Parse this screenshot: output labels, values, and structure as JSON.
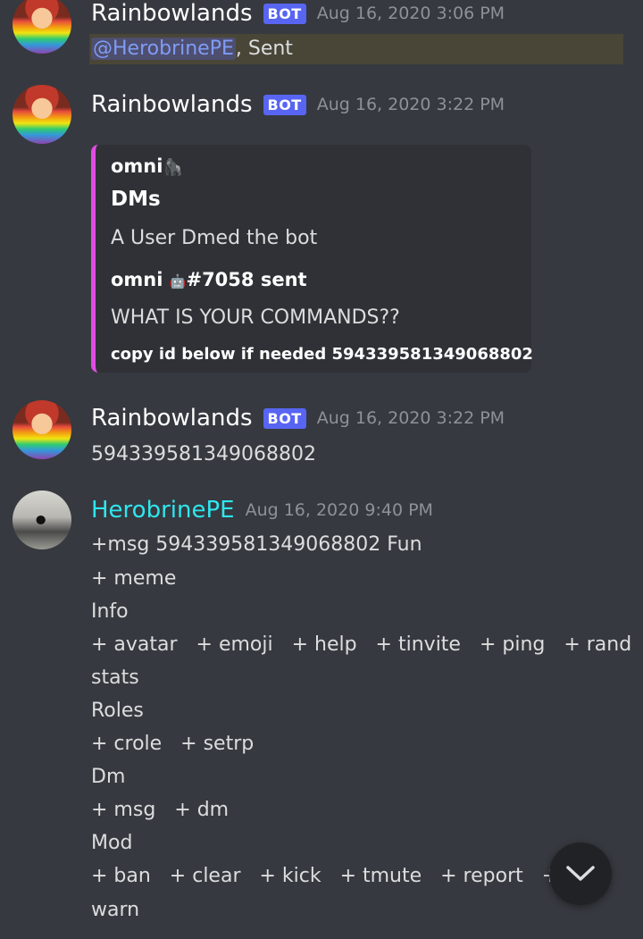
{
  "messages": [
    {
      "author": "Rainbowlands",
      "bot_tag": "BOT",
      "timestamp": "Aug 16, 2020 3:06 PM",
      "mention": "@HerobrinePE",
      "content_after_mention": ", Sent"
    },
    {
      "author": "Rainbowlands",
      "bot_tag": "BOT",
      "timestamp": "Aug 16, 2020 3:22 PM",
      "embed": {
        "author": "omni",
        "title": "DMs",
        "description": "A User Dmed the bot",
        "field_name_prefix": "omni",
        "field_name_suffix": "#7058 sent",
        "field_value": "WHAT IS YOUR COMMANDS??",
        "footer": "copy id below if needed 594339581349068802",
        "accent_color": "#e24ce3"
      }
    },
    {
      "author": "Rainbowlands",
      "bot_tag": "BOT",
      "timestamp": "Aug 16, 2020 3:22 PM",
      "content": "594339581349068802"
    },
    {
      "author": "HerobrinePE",
      "timestamp": "Aug 16, 2020 9:40 PM",
      "lines": [
        "+msg 594339581349068802 Fun",
        "+ meme",
        "Info",
        "+ avatar   + emoji   + help   + tinvite   + ping   + rand   +",
        "stats",
        "Roles",
        "+ crole   + setrp",
        "Dm",
        "+ msg   + dm",
        "Mod",
        "+ ban   + clear   + kick   + tmute   + report   + say",
        "warn"
      ]
    }
  ],
  "jump_button": {
    "icon": "chevron-down-icon"
  }
}
